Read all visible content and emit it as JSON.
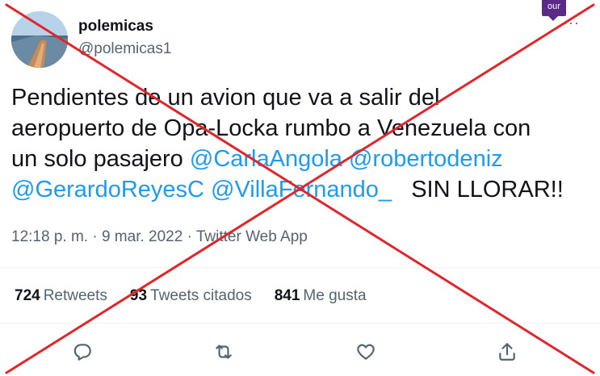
{
  "author": {
    "display_name": "polemicas",
    "handle": "@polemicas1"
  },
  "badge": {
    "label": "our"
  },
  "tweet": {
    "text_1": "Pendientes de un avion que va a salir del\naeropuerto de Opa-Locka rumbo a Venezuela con\nun solo pasajero ",
    "mention_1": "@CarlaAngola",
    "space_1": " ",
    "mention_2": "@robertodeniz",
    "newline": "\n",
    "mention_3": "@GerardoReyesC",
    "space_2": " ",
    "mention_4": "@VillaFernando_",
    "text_2": "   SIN LLORAR!!"
  },
  "meta": {
    "time": "12:18 p. m.",
    "sep_1": " · ",
    "date": "9 mar. 2022",
    "sep_2": " · ",
    "source": "Twitter Web App"
  },
  "stats": {
    "retweets_count": "724",
    "retweets_label": "Retweets",
    "quotes_count": "93",
    "quotes_label": "Tweets citados",
    "likes_count": "841",
    "likes_label": "Me gusta"
  },
  "icons": {
    "reply": "reply-icon",
    "retweet": "retweet-icon",
    "like": "heart-icon",
    "share": "share-icon",
    "more": "more-icon"
  },
  "colors": {
    "mention": "#1d9bf0",
    "secondary_text": "#536471",
    "cross_mark": "#e0252b",
    "badge": "#5b2a86"
  }
}
